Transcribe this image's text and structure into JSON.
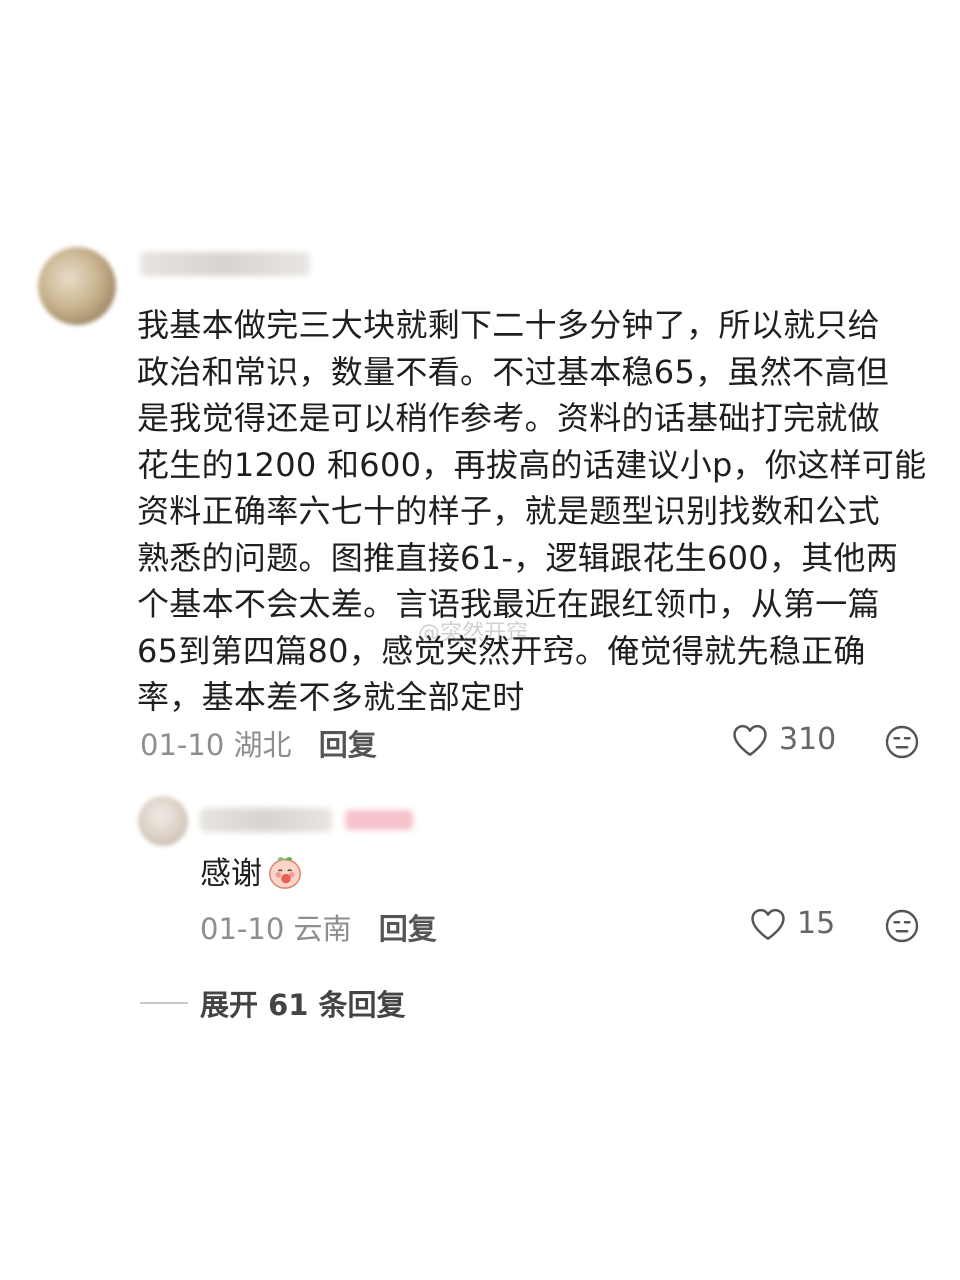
{
  "main_comment": {
    "avatar_icon": "user-avatar-blurred",
    "username_blurred": true,
    "text_lines": [
      "我基本做完三大块就剩下二十多分钟了，所以就只给",
      "政治和常识，数量不看。不过基本稳65，虽然不高但",
      "是我觉得还是可以稍作参考。资料的话基础打完就做",
      "花生的1200 和600，再拔高的话建议小p，你这样可能",
      "资料正确率六七十的样子，就是题型识别找数和公式",
      "熟悉的问题。图推直接61-，逻辑跟花生600，其他两",
      "个基本不会太差。言语我最近在跟红领巾，从第一篇",
      "65到第四篇80，感觉突然开窍。俺觉得就先稳正确",
      "率，基本差不多就全部定时"
    ],
    "date": "01-10",
    "location": "湖北",
    "reply_label": "回复",
    "like_count": "310",
    "like_icon": "heart-outline-icon",
    "emoji_icon": "neutral-face-icon"
  },
  "reply_comment": {
    "avatar_icon": "user-avatar-blurred",
    "username_blurred": true,
    "text": "感谢",
    "sticker_icon": "peach-shy-sticker",
    "date": "01-10",
    "location": "云南",
    "reply_label": "回复",
    "like_count": "15",
    "like_icon": "heart-outline-icon",
    "emoji_icon": "neutral-face-icon"
  },
  "expand_replies": {
    "label": "展开 61 条回复"
  },
  "watermark": {
    "text": "@突然开窍"
  }
}
